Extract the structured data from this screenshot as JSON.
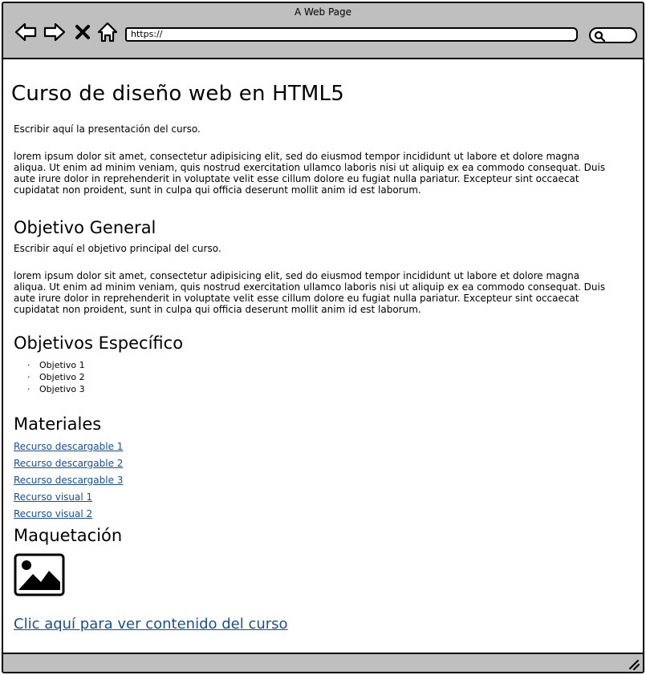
{
  "window": {
    "title": "A Web Page",
    "url": "https://"
  },
  "icons": {
    "back": "arrow-left-icon",
    "forward": "arrow-right-icon",
    "stop": "close-icon",
    "home": "home-icon",
    "search": "search-icon",
    "image": "image-icon",
    "resize": "resize-grip-icon"
  },
  "page": {
    "title": "Curso de diseño web en HTML5",
    "intro": "Escribir aquí la presentación del curso.",
    "intro_body": "lorem ipsum dolor sit amet, consectetur adipisicing elit, sed do eiusmod tempor incididunt ut labore et dolore magna aliqua. Ut enim ad minim veniam, quis nostrud exercitation ullamco laboris nisi ut aliquip ex ea commodo consequat. Duis aute irure dolor in reprehenderit in voluptate velit esse cillum dolore eu fugiat nulla pariatur. Excepteur sint occaecat cupidatat non proident, sunt in culpa qui officia deserunt mollit anim id est laborum.",
    "general": {
      "heading": "Objetivo General",
      "text": "Escribir aquí el objetivo principal del curso.",
      "body": "lorem ipsum dolor sit amet, consectetur adipisicing elit, sed do eiusmod tempor incididunt ut labore et dolore magna aliqua. Ut enim ad minim veniam, quis nostrud exercitation ullamco laboris nisi ut aliquip ex ea commodo consequat. Duis aute irure dolor in reprehenderit in voluptate velit esse cillum dolore eu fugiat nulla pariatur. Excepteur sint occaecat cupidatat non proident, sunt in culpa qui officia deserunt mollit anim id est laborum."
    },
    "specific": {
      "heading": "Objetivos Específico",
      "items": [
        "Objetivo 1",
        "Objetivo 2",
        "Objetivo 3"
      ]
    },
    "materials": {
      "heading": "Materiales",
      "links": [
        "Recurso descargable 1",
        "Recurso descargable 2",
        "Recurso descargable 3",
        "Recurso visual 1",
        "Recurso visual 2"
      ]
    },
    "layout": {
      "heading": "Maquetación"
    },
    "cta": "Clic aquí para ver contenido del curso"
  }
}
